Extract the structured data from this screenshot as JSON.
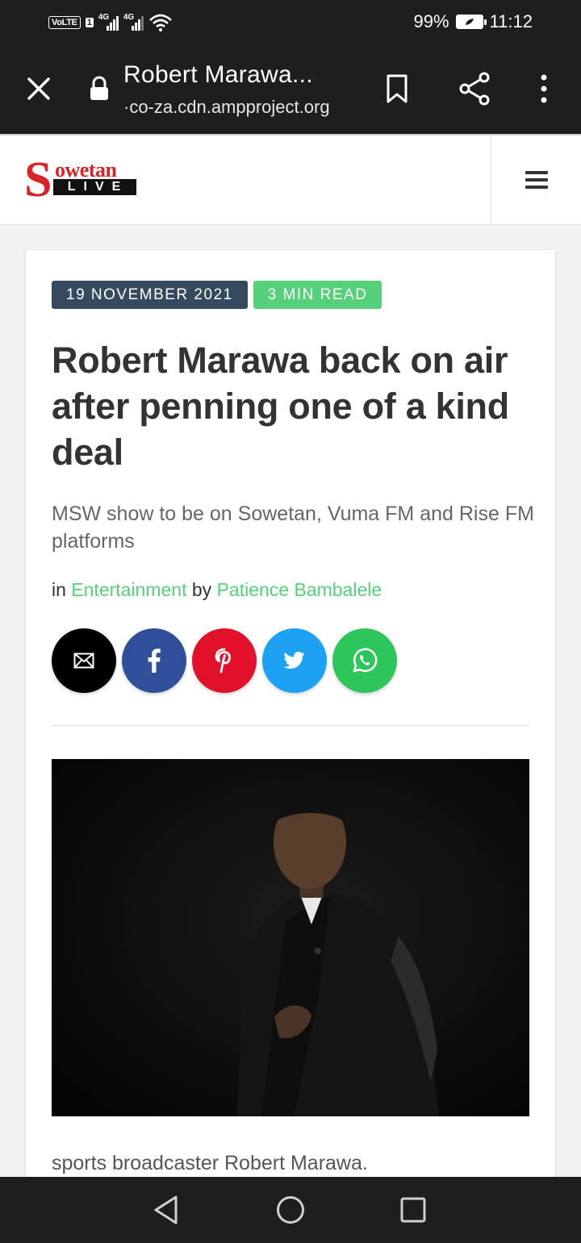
{
  "status_bar": {
    "network_badge": "VoLTE",
    "sim_number": "1",
    "signal_1": "4G",
    "signal_2": "4G",
    "battery_percent": "99%",
    "time": "11:12"
  },
  "browser": {
    "title": "Robert Marawa...",
    "url": "·co-za.cdn.ampproject.org"
  },
  "site": {
    "logo_top": "owetan",
    "logo_s": "S",
    "logo_bottom": "LIVE",
    "brand_color": "#d7242b"
  },
  "article": {
    "date_tag": "19 NOVEMBER 2021",
    "read_tag": "3 MIN READ",
    "headline": "Robert Marawa back on air after penning one of a kind deal",
    "subheadline": "MSW show to be on Sowetan, Vuma FM and Rise FM platforms",
    "byline_in": "in",
    "category": "Entertainment",
    "byline_by": "by",
    "author": "Patience Bambalele",
    "caption": "sports broadcaster Robert Marawa."
  },
  "share_buttons": [
    {
      "name": "email",
      "icon": "envelope-icon",
      "color": "#000000"
    },
    {
      "name": "facebook",
      "icon": "facebook-icon",
      "color": "#2f4f9a"
    },
    {
      "name": "pinterest",
      "icon": "pinterest-icon",
      "color": "#e1112a"
    },
    {
      "name": "twitter",
      "icon": "twitter-icon",
      "color": "#1da1f2"
    },
    {
      "name": "whatsapp",
      "icon": "whatsapp-icon",
      "color": "#2dc65b"
    }
  ],
  "colors": {
    "accent_green": "#56d07a",
    "date_tag_bg": "#354a5f",
    "chrome_dark": "#1e1e1e"
  }
}
